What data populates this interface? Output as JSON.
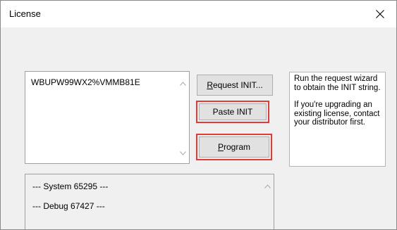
{
  "window": {
    "title": "License",
    "close_label": "Close"
  },
  "init_field": {
    "value": "WBUPW99WX2%VMMB81E"
  },
  "buttons": {
    "request_init": {
      "accel": "R",
      "rest": "equest INIT..."
    },
    "paste_init": {
      "label": "Paste INIT"
    },
    "program": {
      "accel": "P",
      "rest": "rogram"
    }
  },
  "help": {
    "paragraph1": "Run the request wizard to obtain the INIT string.",
    "paragraph2": "If you're upgrading an existing license, contact your distributor first."
  },
  "log": {
    "lines": [
      "--- System 65295 ---",
      "--- Debug 67427 ---"
    ]
  },
  "icons": {
    "close": "close-icon",
    "scroll_up": "chevron-up-icon",
    "scroll_down": "chevron-down-icon"
  },
  "colors": {
    "highlight": "#e53935",
    "button_face": "#e1e1e1",
    "dialog_bg": "#f0f0f0"
  }
}
